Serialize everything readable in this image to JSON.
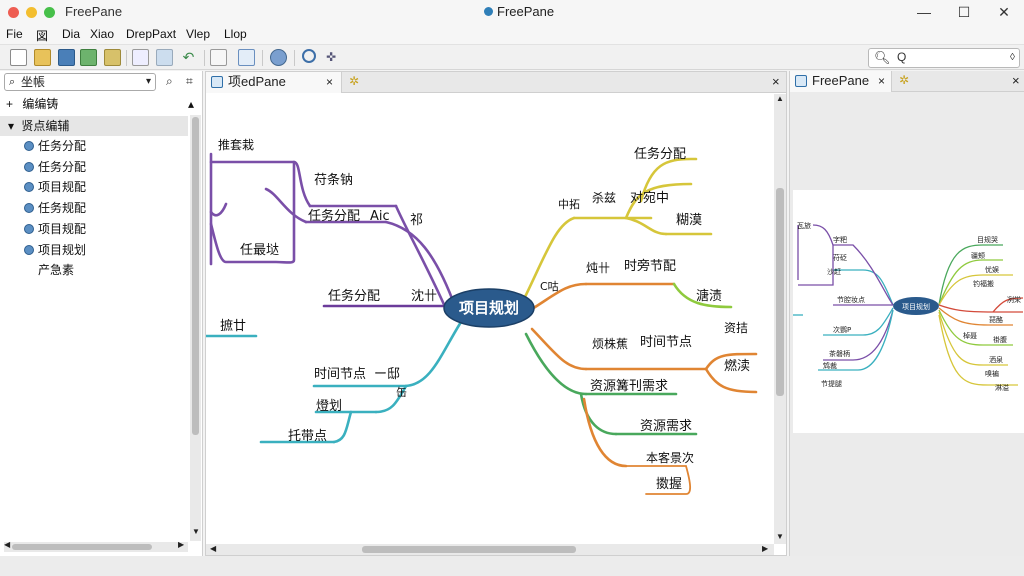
{
  "window": {
    "app_name": "FreePane",
    "center_title": "FreePane",
    "controls": {
      "minimize": "—",
      "maximize": "☐",
      "close": "✕"
    }
  },
  "menu": [
    "Fie",
    "図",
    "Dia",
    "Xiao",
    "DrepPaxt",
    "Vlep",
    "Llop"
  ],
  "toolbar": {
    "search_value": "Q",
    "search_icon": "search-icon"
  },
  "left_panel": {
    "filter_value": "坐帳",
    "items": [
      {
        "label": "编编铸",
        "expander": "+"
      },
      {
        "label": "贤点编辅",
        "expander": "▾"
      },
      {
        "label": "任务分配"
      },
      {
        "label": "任务分配"
      },
      {
        "label": "项目规配"
      },
      {
        "label": "任务规配"
      },
      {
        "label": "项目规配"
      },
      {
        "label": "项目规划"
      },
      {
        "label": "产急素"
      }
    ]
  },
  "center_pane": {
    "tab_label": "项edPane",
    "mindmap": {
      "root": "项目规划",
      "labels": {
        "l_top_left": "推套栽",
        "l_1": "苻条钠",
        "l_2": "任务分配",
        "l_2b": "Aic",
        "l_2c": "祁",
        "l_3": "任最垯",
        "l_4": "任务分配",
        "l_4b": "沈卄",
        "l_5": "摭廿",
        "l_6": "时间节点",
        "l_6b": "ー邸",
        "l_6c": "缶",
        "l_7": "燈划",
        "l_8": "托带点",
        "r_1": "任务分配",
        "r_1b": "中拓",
        "r_1c": "杀兹",
        "r_1d": "对宛中",
        "r_1e": "糊漠",
        "r_2": "时旁节配",
        "r_2b": "炖卄",
        "r_2c": "C咕",
        "r_2d": "溏渍",
        "r_3": "时间节点",
        "r_3b": "烦株蕉",
        "r_3c": "资拮",
        "r_3d": "燃渎",
        "r_4": "资源篝刊需求",
        "r_5": "资源需求",
        "r_6": "本客景次",
        "r_7": "擞握"
      }
    }
  },
  "right_pane": {
    "tab_label": "FreePane",
    "mini_root": "项目规划",
    "mini_labels": [
      "瓦旅",
      "字粑",
      "苻砭",
      "沙赶",
      "节腔妆点",
      "次鹦P",
      "茶磐柄",
      "鸩裁",
      "节提腿",
      "目规哭",
      "疆颊",
      "忧娱",
      "钓褔搬",
      "冽栄",
      "琵酪",
      "棹聂",
      "褂腹",
      "洒泉",
      "嗅褊",
      "淋溢"
    ]
  },
  "colors": {
    "root_fill": "#2a5a8c",
    "purple": "#7a4fa8",
    "teal": "#3ab0bf",
    "yellow": "#d6c63a",
    "orange": "#e08533",
    "green": "#49a85c",
    "light_green": "#8fca3e",
    "red": "#d34a3a"
  }
}
